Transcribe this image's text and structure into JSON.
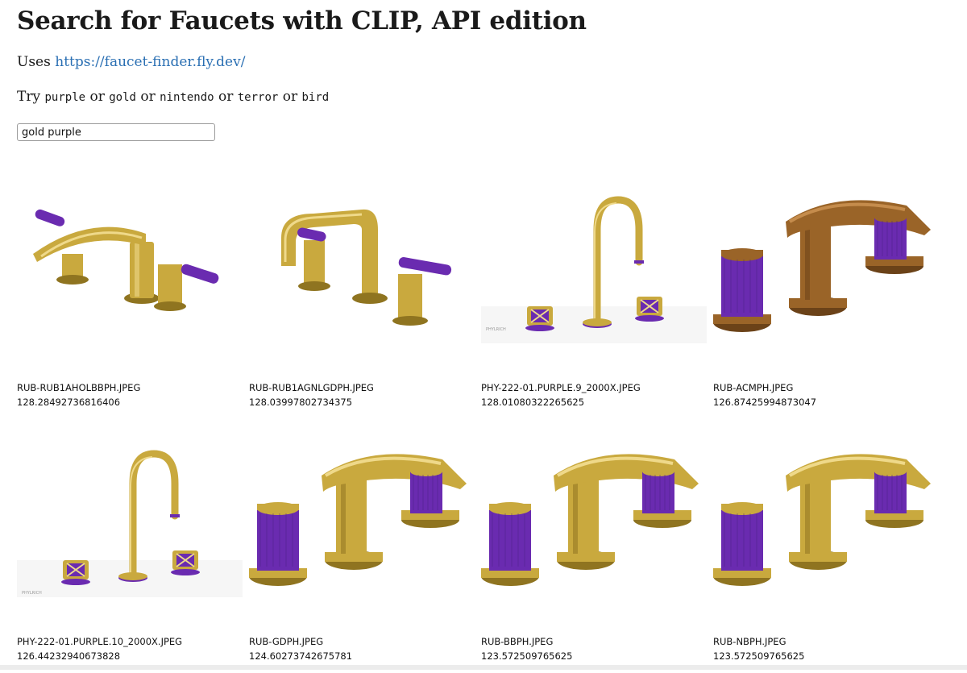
{
  "title": "Search for Faucets with CLIP, API edition",
  "uses": {
    "prefix": "Uses ",
    "link": "https://faucet-finder.fly.dev/"
  },
  "try": {
    "prefix": "Try ",
    "sep": " or ",
    "terms": [
      "purple",
      "gold",
      "nintendo",
      "terror",
      "bird"
    ]
  },
  "search": {
    "value": "gold purple"
  },
  "colors": {
    "gold": "#c9a93e",
    "bronze": "#9a6428",
    "purple": "#6a2bb0",
    "link": "#2a6fb3"
  },
  "results": [
    {
      "filename": "RUB-RUB1AHOLBBPH.JPEG",
      "score": "128.28492736816406",
      "finish": "gold",
      "style": "lever",
      "image": "faucet-image"
    },
    {
      "filename": "RUB-RUB1AGNLGDPH.JPEG",
      "score": "128.03997802734375",
      "finish": "gold",
      "style": "lever-tall",
      "image": "faucet-image"
    },
    {
      "filename": "PHY-222-01.PURPLE.9_2000X.JPEG",
      "score": "128.01080322265625",
      "finish": "gold",
      "style": "gooseneck",
      "image": "faucet-image",
      "watermark": "PHYLRICH"
    },
    {
      "filename": "RUB-ACMPH.JPEG",
      "score": "126.87425994873047",
      "finish": "bronze",
      "style": "knurled",
      "image": "faucet-image"
    },
    {
      "filename": "PHY-222-01.PURPLE.10_2000X.JPEG",
      "score": "126.44232940673828",
      "finish": "gold",
      "style": "gooseneck",
      "image": "faucet-image",
      "watermark": "PHYLRICH"
    },
    {
      "filename": "RUB-GDPH.JPEG",
      "score": "124.60273742675781",
      "finish": "gold",
      "style": "knurled",
      "image": "faucet-image"
    },
    {
      "filename": "RUB-BBPH.JPEG",
      "score": "123.572509765625",
      "finish": "gold",
      "style": "knurled",
      "image": "faucet-image"
    },
    {
      "filename": "RUB-NBPH.JPEG",
      "score": "123.572509765625",
      "finish": "gold",
      "style": "knurled",
      "image": "faucet-image"
    }
  ]
}
